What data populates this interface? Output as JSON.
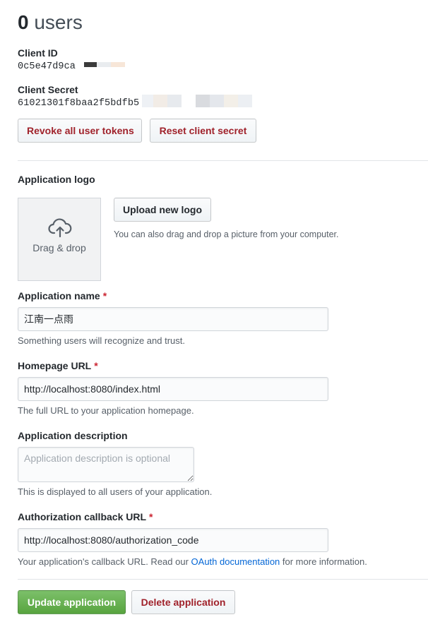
{
  "users": {
    "count": "0",
    "label": "users"
  },
  "client_id": {
    "label": "Client ID",
    "value": "0c5e47d9ca"
  },
  "client_secret": {
    "label": "Client Secret",
    "value": "61021301f8baa2f5bdfb5"
  },
  "buttons": {
    "revoke": "Revoke all user tokens",
    "reset": "Reset client secret",
    "upload": "Upload new logo",
    "update": "Update application",
    "delete": "Delete application"
  },
  "logo": {
    "label": "Application logo",
    "dropzone": "Drag & drop",
    "hint": "You can also drag and drop a picture from your computer."
  },
  "app_name": {
    "label": "Application name",
    "required": "*",
    "value": "江南一点雨",
    "note": "Something users will recognize and trust."
  },
  "homepage": {
    "label": "Homepage URL",
    "required": "*",
    "value": "http://localhost:8080/index.html",
    "note": "The full URL to your application homepage."
  },
  "description": {
    "label": "Application description",
    "placeholder": "Application description is optional",
    "note": "This is displayed to all users of your application."
  },
  "callback": {
    "label": "Authorization callback URL",
    "required": "*",
    "value": "http://localhost:8080/authorization_code",
    "note_before": "Your application's callback URL. Read our ",
    "note_link": "OAuth documentation",
    "note_after": " for more information."
  },
  "colors": {
    "danger_text": "#a0222b",
    "primary_green": "#58a43f",
    "link_blue": "#0366d6",
    "required_red": "#cb2431"
  }
}
